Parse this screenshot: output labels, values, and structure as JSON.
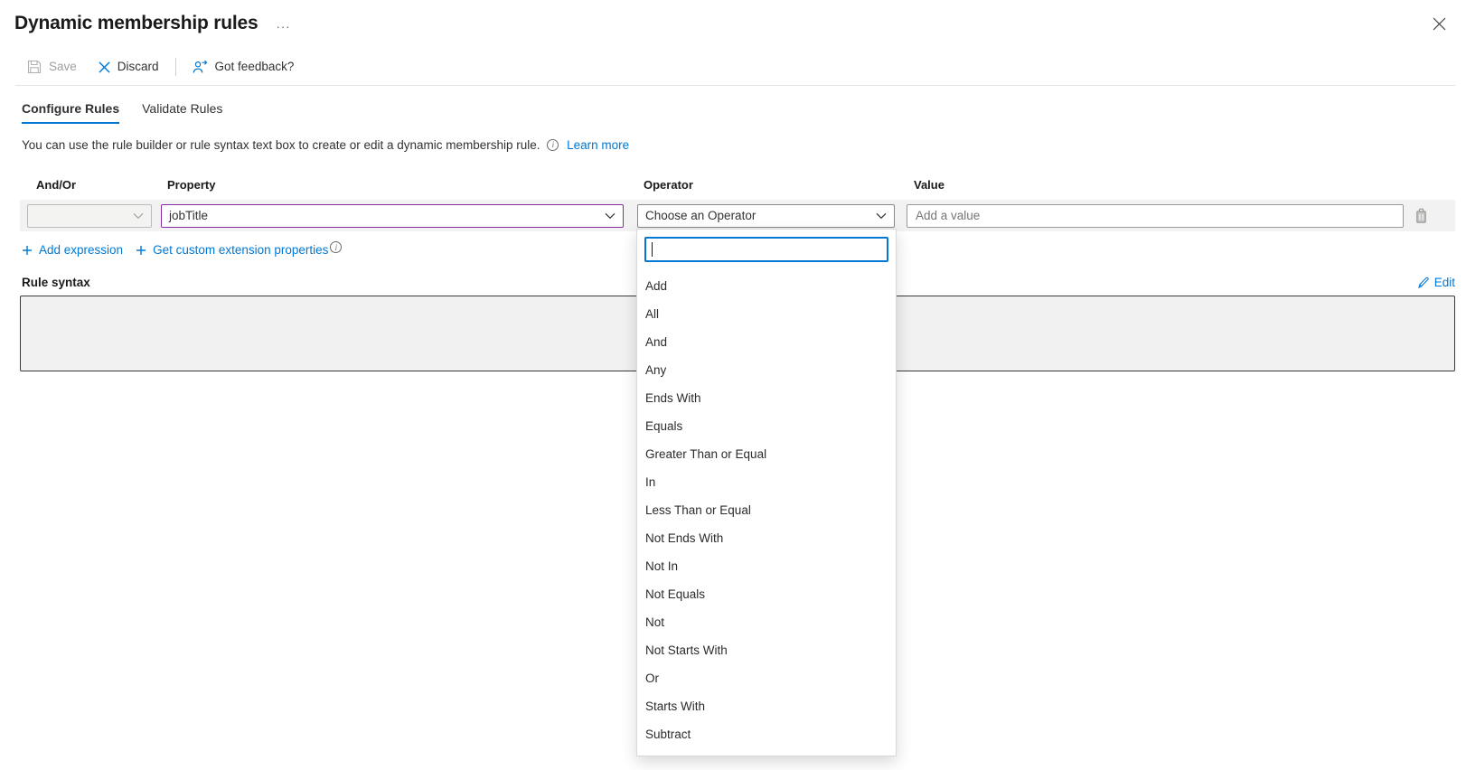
{
  "window": {
    "title": "Dynamic membership rules",
    "more_options_glyph": "···"
  },
  "toolbar": {
    "save_label": "Save",
    "discard_label": "Discard",
    "feedback_label": "Got feedback?"
  },
  "tabs": [
    {
      "label": "Configure Rules",
      "active": true
    },
    {
      "label": "Validate Rules",
      "active": false
    }
  ],
  "description": {
    "text": "You can use the rule builder or rule syntax text box to create or edit a dynamic membership rule.",
    "learn_more_label": "Learn more"
  },
  "rule_builder": {
    "column_headers": [
      "And/Or",
      "Property",
      "Operator",
      "Value"
    ],
    "row": {
      "and_or_value": "",
      "property_value": "jobTitle",
      "operator_value": "Choose an Operator",
      "value_placeholder": "Add a value"
    },
    "add_expression_label": "Add expression",
    "get_custom_props_label": "Get custom extension properties"
  },
  "operator_dropdown": {
    "search_value": "",
    "options": [
      "Add",
      "All",
      "And",
      "Any",
      "Ends With",
      "Equals",
      "Greater Than or Equal",
      "In",
      "Less Than or Equal",
      "Not Ends With",
      "Not In",
      "Not Equals",
      "Not",
      "Not Starts With",
      "Or",
      "Starts With",
      "Subtract"
    ]
  },
  "rule_syntax": {
    "label": "Rule syntax",
    "edit_label": "Edit",
    "content": ""
  },
  "colors": {
    "accent_blue": "#0078d4",
    "property_border_purple": "#8a2da5",
    "disabled_text": "#a19f9d",
    "row_background": "#f2f2f2",
    "syntax_box_background": "#f1f1f1"
  }
}
